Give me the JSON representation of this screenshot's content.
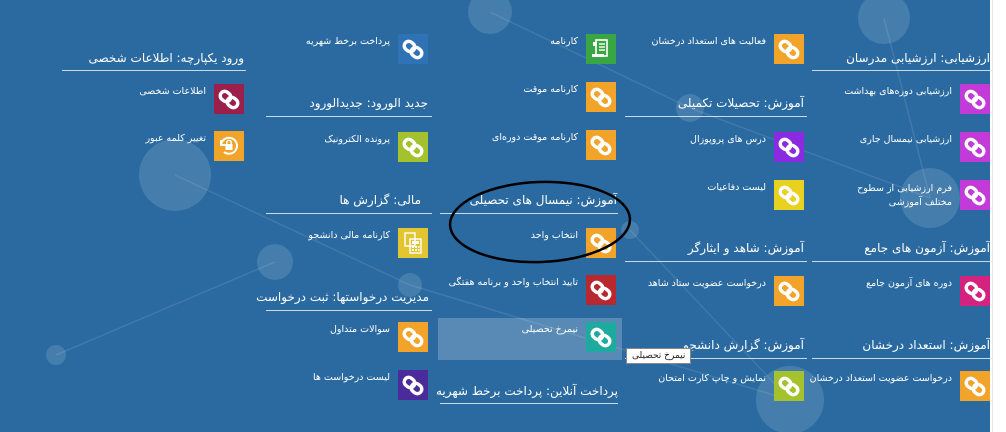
{
  "colors": {
    "background": "#2a6aa0",
    "orange": "#f1a32a",
    "crimson": "#9b1f4a",
    "blue": "#2f73b6",
    "lime": "#a3c22d",
    "green": "#3aa543",
    "purple": "#8a2be2",
    "violet": "#4b2a9b",
    "teal": "#1faaa0",
    "yellow": "#e8d21f",
    "gold": "#e3c531",
    "red": "#b8282e",
    "magenta": "#d4237e",
    "fuchsia": "#c23ad8"
  },
  "sections": {
    "personal": {
      "title": "ورود یکپارچه: اطلاعات شخصی"
    },
    "new_entry": {
      "title": "جدید الورود: جدیدالورود"
    },
    "finance": {
      "title": "مالی: گزارش ها"
    },
    "requests": {
      "title": "مدیریت درخواستها: ثبت درخواست"
    },
    "online_pay": {
      "title": "پرداخت آنلاین: پرداخت برخط شهریه"
    },
    "semester": {
      "title": "آموزش: نیمسال های تحصیلی"
    },
    "complementary": {
      "title": "آموزش: تحصیلات تکمیلی"
    },
    "witness": {
      "title": "آموزش: شاهد و ایثارگر"
    },
    "student_report": {
      "title": "آموزش: گزارش دانشجو"
    },
    "evaluation": {
      "title": "ارزشیابی: ارزشیابی مدرسان"
    },
    "comprehensive": {
      "title": "آموزش: آزمون های جامع"
    },
    "talent": {
      "title": "آموزش: استعداد درخشان"
    }
  },
  "tiles": {
    "personal_info": {
      "label": "اطلاعات شخصی",
      "icon": "link-icon",
      "color": "crimson"
    },
    "change_password": {
      "label": "تغییر کلمه عبور",
      "icon": "lock-refresh-icon",
      "color": "orange"
    },
    "pay_tuition": {
      "label": "پرداخت برخط شهریه",
      "icon": "link-icon",
      "color": "blue"
    },
    "electronic_file": {
      "label": "پرونده الکترونیک",
      "icon": "link-icon",
      "color": "lime"
    },
    "finance_card": {
      "label": "کارنامه مالی دانشجو",
      "icon": "calculator-icon",
      "color": "gold"
    },
    "faq": {
      "label": "سوالات متداول",
      "icon": "link-icon",
      "color": "orange"
    },
    "request_list": {
      "label": "لیست درخواست ها",
      "icon": "link-icon",
      "color": "violet"
    },
    "transcript": {
      "label": "کارنامه",
      "icon": "document-icon",
      "color": "green"
    },
    "temp_transcript": {
      "label": "کارنامه موقت",
      "icon": "link-icon",
      "color": "orange"
    },
    "temp_transcript_periodic": {
      "label": "کارنامه موقت دوره‌ای",
      "icon": "link-icon",
      "color": "orange"
    },
    "course_select": {
      "label": "انتخاب واحد",
      "icon": "link-icon",
      "color": "orange"
    },
    "confirm_select": {
      "label": "تایید انتخاب واحد و برنامه هفتگی",
      "icon": "link-icon",
      "color": "red"
    },
    "academic_profile": {
      "label": "نیمرخ تحصیلی",
      "icon": "link-icon",
      "color": "teal"
    },
    "talent_activities": {
      "label": "فعالیت های استعداد درخشان",
      "icon": "link-icon",
      "color": "orange"
    },
    "pro_courses": {
      "label": "درس های پروپوزال",
      "icon": "link-icon",
      "color": "purple"
    },
    "defense_list": {
      "label": "لیست دفاعیات",
      "icon": "link-icon",
      "color": "yellow"
    },
    "witness_membership": {
      "label": "درخواست عضویت ستاد شاهد",
      "icon": "link-icon",
      "color": "orange"
    },
    "exam_card": {
      "label": "نمایش و چاپ کارت امتحان",
      "icon": "link-icon",
      "color": "lime"
    },
    "health_eval": {
      "label": "ارزشیابی دوره‌های بهداشت",
      "icon": "link-icon",
      "color": "fuchsia"
    },
    "current_eval": {
      "label": "ارزشیابی نیمسال جاری",
      "icon": "link-icon",
      "color": "fuchsia"
    },
    "multilevel_eval": {
      "label": "فرم ارزشیابی از سطوح مختلف آموزشی",
      "icon": "link-icon",
      "color": "fuchsia"
    },
    "comprehensive_exam": {
      "label": "دوره های آزمون جامع",
      "icon": "link-icon",
      "color": "magenta"
    },
    "talent_membership": {
      "label": "درخواست عضویت استعداد درخشان",
      "icon": "link-icon",
      "color": "orange"
    }
  },
  "tooltip": {
    "text": "نیمرخ تحصیلی"
  }
}
